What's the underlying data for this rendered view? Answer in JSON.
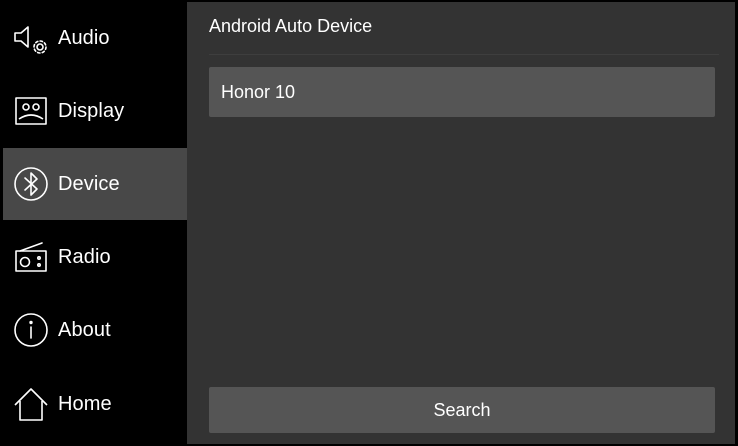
{
  "sidebar": {
    "items": [
      {
        "label": "Audio",
        "icon": "audio-settings-icon"
      },
      {
        "label": "Display",
        "icon": "display-icon"
      },
      {
        "label": "Device",
        "icon": "bluetooth-icon",
        "active": true
      },
      {
        "label": "Radio",
        "icon": "radio-icon"
      },
      {
        "label": "About",
        "icon": "info-icon"
      },
      {
        "label": "Home",
        "icon": "home-icon"
      }
    ]
  },
  "main": {
    "title": "Android Auto Device",
    "devices": [
      "Honor 10"
    ],
    "search_label": "Search"
  },
  "colors": {
    "sidebar_bg": "#000000",
    "active_item_bg": "#484848",
    "panel_bg": "#333333",
    "control_bg": "#555555",
    "text": "#ffffff"
  }
}
